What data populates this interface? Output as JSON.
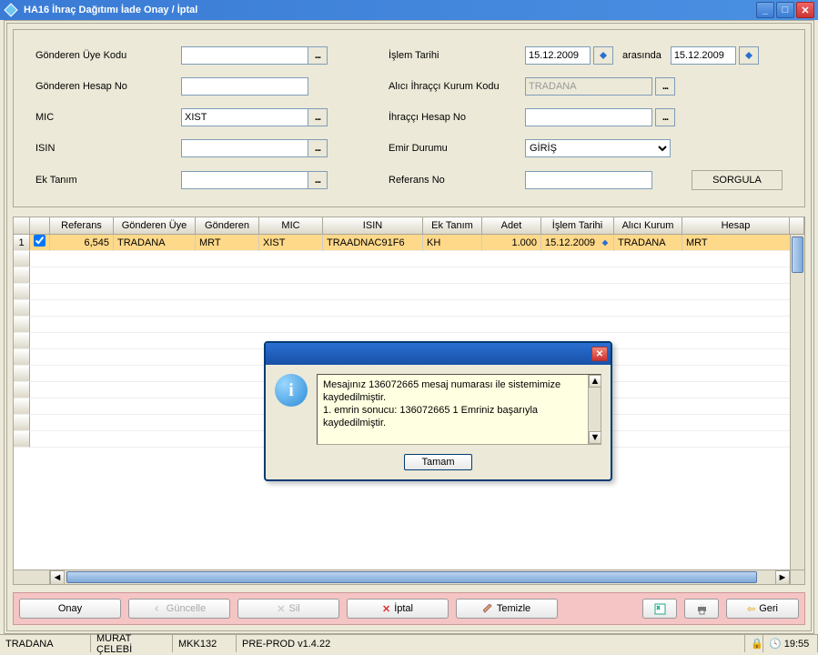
{
  "title": "HA16 İhraç Dağıtımı İade Onay / İptal",
  "form": {
    "gonderen_uye_kodu_label": "Gönderen Üye Kodu",
    "gonderen_uye_kodu": "",
    "gonderen_hesap_no_label": "Gönderen Hesap No",
    "gonderen_hesap_no": "",
    "mic_label": "MIC",
    "mic": "XIST",
    "isin_label": "ISIN",
    "isin": "",
    "ek_tanim_label": "Ek Tanım",
    "ek_tanim": "",
    "islem_tarihi_label": "İşlem Tarihi",
    "islem_tarihi_from": "15.12.2009",
    "arasinda": "arasında",
    "islem_tarihi_to": "15.12.2009",
    "alici_kurum_label": "Alıcı İhraççı Kurum Kodu",
    "alici_kurum": "TRADANA",
    "ihr_hesap_no_label": "İhraççı Hesap No",
    "ihr_hesap_no": "",
    "emir_durumu_label": "Emir Durumu",
    "emir_durumu": "GİRİŞ",
    "referans_no_label": "Referans No",
    "referans_no": "",
    "sorgula": "SORGULA"
  },
  "grid": {
    "headers": [
      "",
      "",
      "Referans",
      "Gönderen Üye",
      "Gönderen",
      "MIC",
      "ISIN",
      "Ek Tanım",
      "Adet",
      "İşlem Tarihi",
      "Alıcı Kurum",
      "Hesap"
    ],
    "row": {
      "num": "1",
      "referans": "6,545",
      "gonderen_uye": "TRADANA",
      "gonderen": "MRT",
      "mic": "XIST",
      "isin": "TRAADNAC91F6",
      "ek": "KH",
      "adet": "1.000",
      "tarih": "15.12.2009",
      "alici": "TRADANA",
      "hesap": "MRT"
    }
  },
  "dialog": {
    "line1": " Mesajınız 136072665 mesaj numarası ile sistemimize kaydedilmiştir.",
    "line2": "1. emrin sonucu:  136072665   1   Emriniz başarıyla kaydedilmiştir.",
    "ok": "Tamam"
  },
  "actions": {
    "onay": "Onay",
    "guncelle": "Güncelle",
    "sil": "Sil",
    "iptal": "İptal",
    "temizle": "Temizle",
    "geri": "Geri"
  },
  "status": {
    "s1": "TRADANA",
    "s2": "MURAT ÇELEBİ",
    "s3": "MKK132",
    "s4": "PRE-PROD v1.4.22",
    "time": "19:55"
  }
}
